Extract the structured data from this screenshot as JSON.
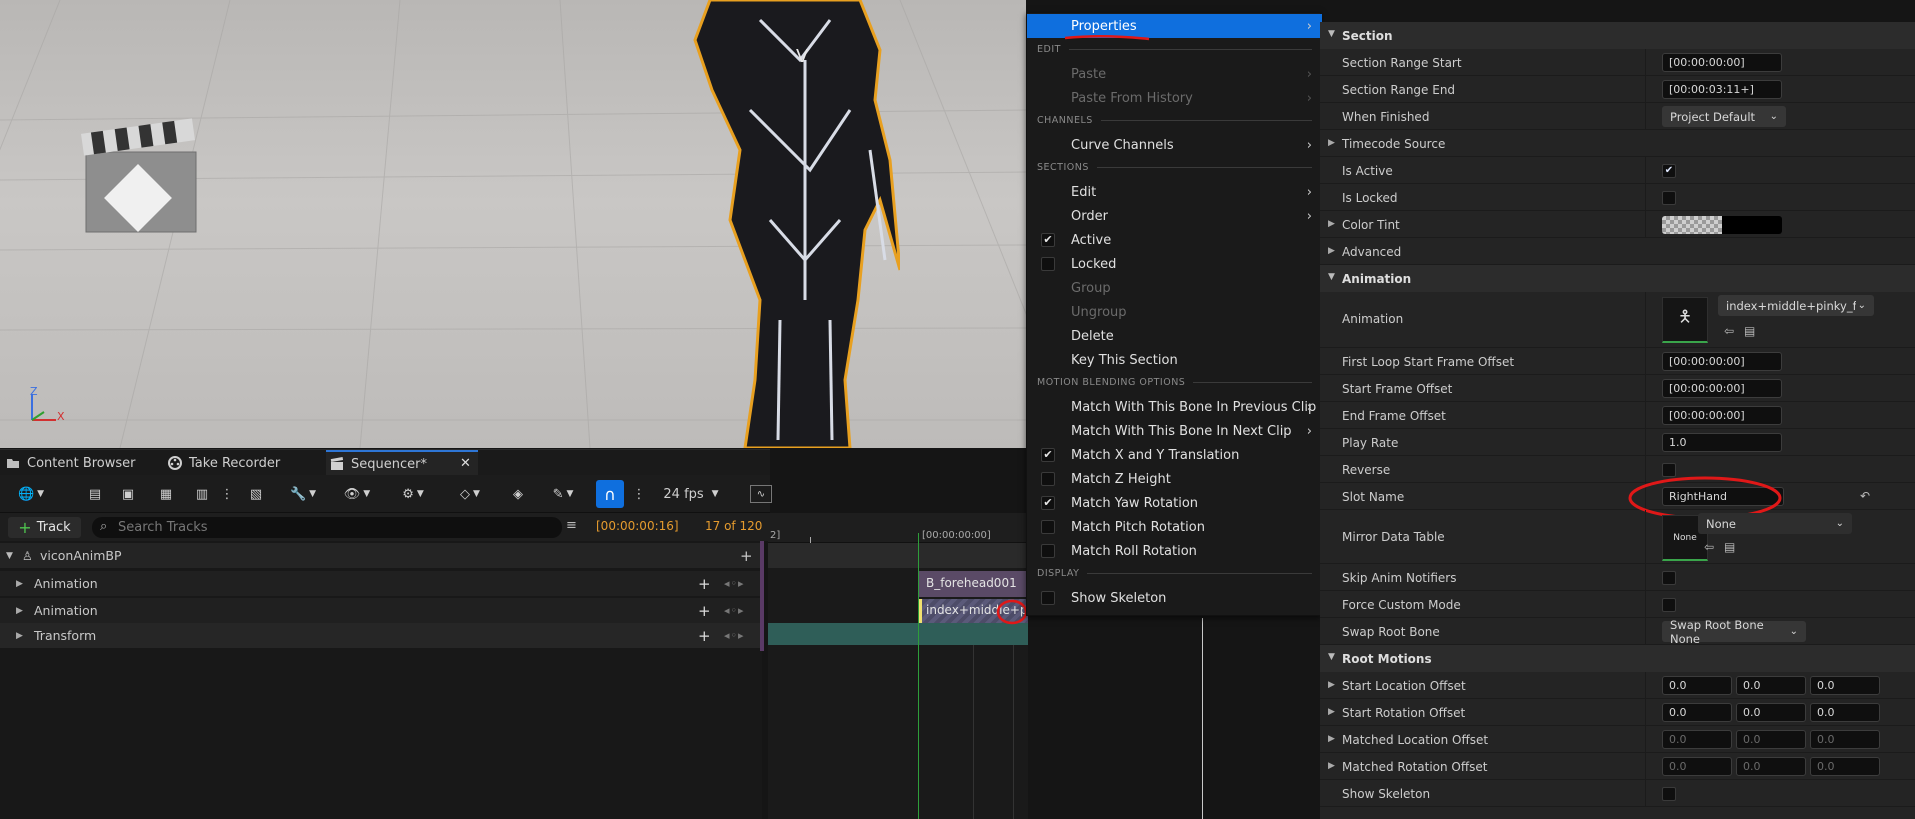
{
  "viewport": {
    "axis_z": "Z",
    "axis_x": "X"
  },
  "tabs": [
    {
      "label": "Content Browser",
      "icon": "folder-icon"
    },
    {
      "label": "Take Recorder",
      "icon": "film-reel-icon"
    },
    {
      "label": "Sequencer*",
      "icon": "clapper-icon",
      "active": true
    }
  ],
  "toolbar": {
    "fps_label": "24 fps",
    "snap_active": true
  },
  "trackbar": {
    "add_track_label": "Track",
    "search_placeholder": "Search Tracks",
    "current_time": "[00:00:00:16]",
    "frame_count": "17 of 120"
  },
  "tracks": {
    "root": "viconAnimBP",
    "rows": [
      {
        "label": "Animation"
      },
      {
        "label": "Animation"
      },
      {
        "label": "Transform"
      }
    ]
  },
  "timeline": {
    "ruler_left": "2]",
    "ruler_start": "[00:00:00:00]",
    "section1_label": "B_forehead001",
    "section2_label": "index+middle+pinky_fo"
  },
  "context_menu": {
    "properties_label": "Properties",
    "sections": {
      "edit": "EDIT",
      "channels": "CHANNELS",
      "sections": "SECTIONS",
      "motion_blending": "MOTION BLENDING OPTIONS",
      "display": "DISPLAY"
    },
    "items": {
      "paste": "Paste",
      "paste_history": "Paste From History",
      "curve_channels": "Curve Channels",
      "edit": "Edit",
      "order": "Order",
      "active": "Active",
      "locked": "Locked",
      "group": "Group",
      "ungroup": "Ungroup",
      "delete": "Delete",
      "key_section": "Key This Section",
      "match_prev": "Match With This Bone In Previous Clip",
      "match_next": "Match With This Bone In Next Clip",
      "match_xy": "Match X and Y Translation",
      "match_z": "Match Z Height",
      "match_yaw": "Match Yaw Rotation",
      "match_pitch": "Match Pitch Rotation",
      "match_roll": "Match Roll Rotation",
      "show_skeleton": "Show Skeleton"
    },
    "checked": {
      "active": true,
      "locked": false,
      "match_xy": true,
      "match_z": false,
      "match_yaw": true,
      "match_pitch": false,
      "match_roll": false,
      "show_skeleton": false
    }
  },
  "details": {
    "cat_section": "Section",
    "section_range_start_label": "Section Range Start",
    "section_range_start": "[00:00:00:00]",
    "section_range_end_label": "Section Range End",
    "section_range_end": "[00:00:03:11+]",
    "when_finished_label": "When Finished",
    "when_finished": "Project Default",
    "timecode_source_label": "Timecode Source",
    "is_active_label": "Is Active",
    "is_locked_label": "Is Locked",
    "color_tint_label": "Color Tint",
    "advanced_label": "Advanced",
    "cat_animation": "Animation",
    "animation_label": "Animation",
    "animation_asset": "index+middle+pinky_for",
    "first_loop_label": "First Loop Start Frame Offset",
    "first_loop": "[00:00:00:00]",
    "start_frame_label": "Start Frame Offset",
    "start_frame": "[00:00:00:00]",
    "end_frame_label": "End Frame Offset",
    "end_frame": "[00:00:00:00]",
    "play_rate_label": "Play Rate",
    "play_rate": "1.0",
    "reverse_label": "Reverse",
    "slot_name_label": "Slot Name",
    "slot_name": "RightHand",
    "mirror_label": "Mirror Data Table",
    "mirror_thumb": "None",
    "mirror_value": "None",
    "skip_notifiers_label": "Skip Anim Notifiers",
    "force_custom_label": "Force Custom Mode",
    "swap_root_label": "Swap Root Bone",
    "swap_root": "Swap Root Bone None",
    "cat_root_motions": "Root Motions",
    "start_loc_label": "Start Location Offset",
    "start_loc": [
      "0.0",
      "0.0",
      "0.0"
    ],
    "start_rot_label": "Start Rotation Offset",
    "start_rot": [
      "0.0",
      "0.0",
      "0.0"
    ],
    "matched_loc_label": "Matched Location Offset",
    "matched_loc": [
      "0.0",
      "0.0",
      "0.0"
    ],
    "matched_rot_label": "Matched Rotation Offset",
    "matched_rot": [
      "0.0",
      "0.0",
      "0.0"
    ],
    "show_skeleton_label": "Show Skeleton"
  },
  "colors": {
    "menu_highlight": "#0f6fde",
    "annotation_red": "#e01818",
    "accent_orange": "#e59b2e",
    "section_purple": "#5a4a66",
    "transform_teal": "#2f5e58"
  }
}
